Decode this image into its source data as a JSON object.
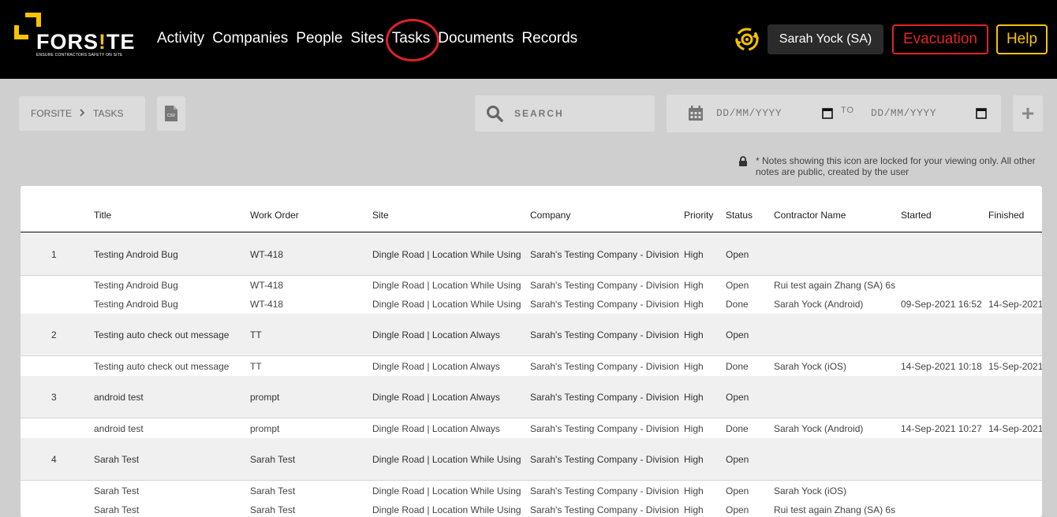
{
  "app": {
    "brand": "FORS!TE",
    "brand_main": "FORS",
    "brand_bang": "!",
    "brand_end": "TE",
    "tagline": "ENSURE CONTRACTORS SAFETY ON SITE",
    "colors": {
      "accent": "#f5c400",
      "evacuation": "#e02424",
      "highlight_circle": "#d8232a",
      "topbar": "#000000"
    }
  },
  "nav": {
    "items": [
      "Activity",
      "Companies",
      "People",
      "Sites",
      "Tasks",
      "Documents",
      "Records"
    ],
    "active": "Tasks"
  },
  "header": {
    "sync_icon": "sync-gear-icon",
    "user": "Sarah Yock (SA)",
    "evacuation": "Evacuation",
    "help": "Help"
  },
  "toolbar": {
    "breadcrumb": [
      "FORSITE",
      "TASKS"
    ],
    "csv_icon": "csv-file-icon",
    "csv_label": "CSV",
    "search_placeholder": "SEARCH",
    "date_from_placeholder": "DD/MM/YYYY",
    "date_to_label": "TO",
    "date_to_placeholder": "DD/MM/YYYY",
    "add_label": "+"
  },
  "note": "* Notes showing this icon are locked for your viewing only. All other notes are public, created by the user",
  "table": {
    "columns": [
      "Title",
      "Work Order",
      "Site",
      "Company",
      "Priority",
      "Status",
      "Contractor Name",
      "Started",
      "Finished"
    ],
    "groups": [
      {
        "num": "1",
        "title": "Testing Android Bug",
        "work_order": "WT-418",
        "site": "Dingle Road | Location While Using",
        "company": "Sarah's Testing Company - Division",
        "priority": "High",
        "status": "Open",
        "subs": [
          {
            "title": "Testing Android Bug",
            "work_order": "WT-418",
            "site": "Dingle Road | Location While Using",
            "company": "Sarah's Testing Company - Division",
            "priority": "High",
            "status": "Open",
            "contractor": "Rui test again Zhang (SA) 6s",
            "started": "",
            "finished": ""
          },
          {
            "title": "Testing Android Bug",
            "work_order": "WT-418",
            "site": "Dingle Road | Location While Using",
            "company": "Sarah's Testing Company - Division",
            "priority": "High",
            "status": "Done",
            "contractor": "Sarah Yock (Android)",
            "started": "09-Sep-2021 16:52",
            "finished": "14-Sep-2021"
          }
        ]
      },
      {
        "num": "2",
        "title": "Testing auto check out message",
        "work_order": "TT",
        "site": "Dingle Road | Location Always",
        "company": "Sarah's Testing Company - Division",
        "priority": "High",
        "status": "Open",
        "subs": [
          {
            "title": "Testing auto check out message",
            "work_order": "TT",
            "site": "Dingle Road | Location Always",
            "company": "Sarah's Testing Company - Division",
            "priority": "High",
            "status": "Done",
            "contractor": "Sarah Yock (iOS)",
            "started": "14-Sep-2021 10:18",
            "finished": "15-Sep-2021"
          }
        ]
      },
      {
        "num": "3",
        "title": "android test",
        "work_order": "prompt",
        "site": "Dingle Road | Location Always",
        "company": "Sarah's Testing Company - Division",
        "priority": "High",
        "status": "Open",
        "subs": [
          {
            "title": "android test",
            "work_order": "prompt",
            "site": "Dingle Road | Location Always",
            "company": "Sarah's Testing Company - Division",
            "priority": "High",
            "status": "Done",
            "contractor": "Sarah Yock (Android)",
            "started": "14-Sep-2021 10:27",
            "finished": "14-Sep-2021"
          }
        ]
      },
      {
        "num": "4",
        "title": "Sarah Test",
        "work_order": "Sarah Test",
        "site": "Dingle Road | Location While Using",
        "company": "Sarah's Testing Company - Division",
        "priority": "High",
        "status": "Open",
        "subs": [
          {
            "title": "Sarah Test",
            "work_order": "Sarah Test",
            "site": "Dingle Road | Location While Using",
            "company": "Sarah's Testing Company - Division",
            "priority": "High",
            "status": "Open",
            "contractor": "Sarah Yock (iOS)",
            "started": "",
            "finished": ""
          },
          {
            "title": "Sarah Test",
            "work_order": "Sarah Test",
            "site": "Dingle Road | Location While Using",
            "company": "Sarah's Testing Company - Division",
            "priority": "High",
            "status": "Open",
            "contractor": "Rui test again Zhang (SA) 6s",
            "started": "",
            "finished": ""
          }
        ]
      }
    ]
  }
}
